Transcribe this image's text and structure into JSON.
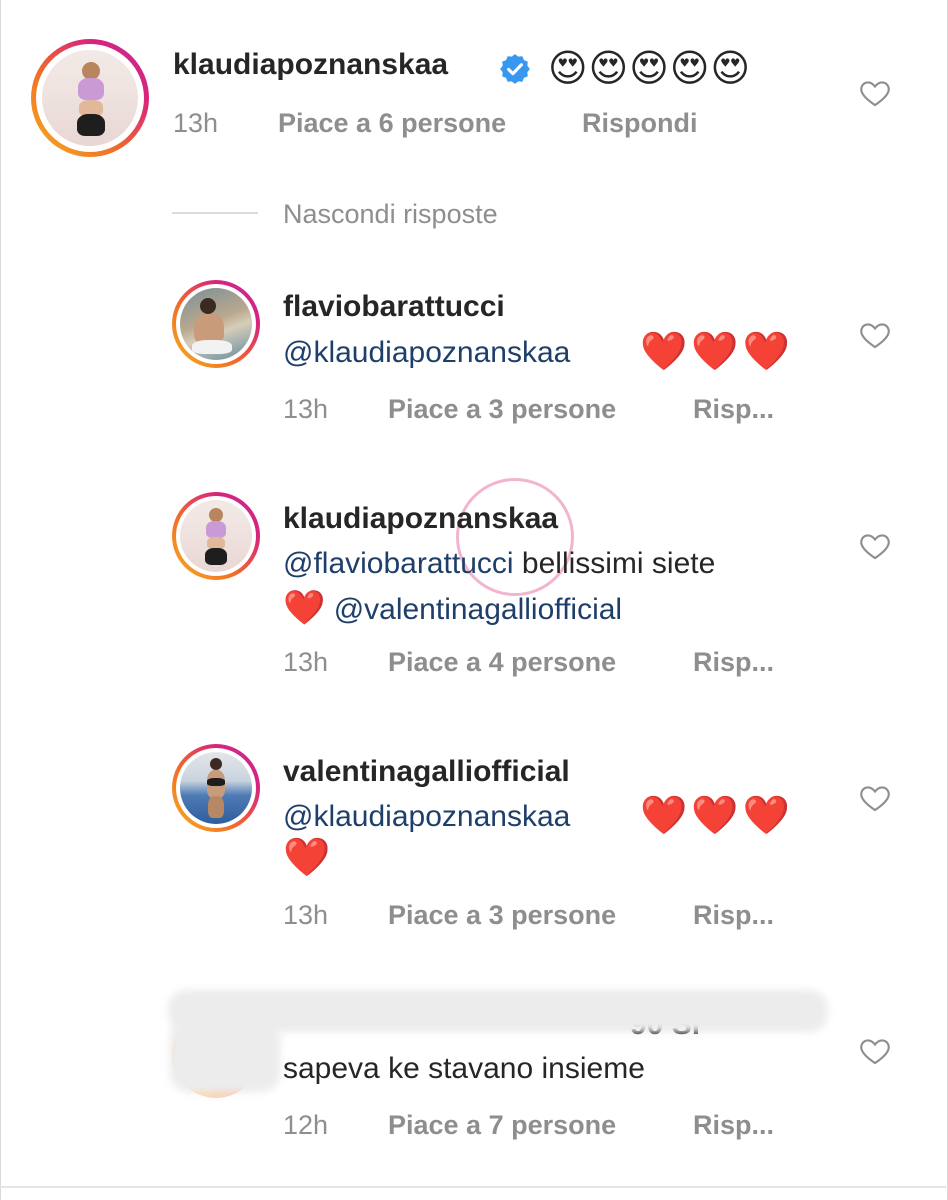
{
  "comment": {
    "username": "klaudiapoznanskaa",
    "verified": true,
    "emojis": "😍😍😍😍😍",
    "time": "13h",
    "likes": "Piace a 6 persone",
    "reply": "Rispondi"
  },
  "hide_replies": "Nascondi risposte",
  "replies": [
    {
      "username": "flaviobarattucci",
      "mention": "@klaudiapoznanskaa",
      "hearts": "❤️❤️❤️",
      "time": "13h",
      "likes": "Piace a 3 persone",
      "reply": "Risp..."
    },
    {
      "username": "klaudiapoznanskaa",
      "mention": "@flaviobarattucci",
      "text": "bellissimi siete",
      "heart": "❤️",
      "mention2": "@valentinagalliofficial",
      "time": "13h",
      "likes": "Piace a 4 persone",
      "reply": "Risp..."
    },
    {
      "username": "valentinagalliofficial",
      "mention": "@klaudiapoznanskaa",
      "hearts": "❤️❤️❤️",
      "heart_line2": "❤️",
      "time": "13h",
      "likes": "Piace a 3 persone",
      "reply": "Risp..."
    },
    {
      "username_fragment": "90 Si",
      "text": "sapeva ke stavano insieme",
      "time": "12h",
      "likes": "Piace a 7 persone",
      "reply": "Risp..."
    }
  ],
  "colors": {
    "text": "#262626",
    "meta": "#8e8e8e",
    "mention": "#1f3f6b",
    "heart": "#e0182b",
    "verified": "#3897f0"
  },
  "icons": [
    "heart-outline-icon",
    "verified-badge-icon"
  ]
}
